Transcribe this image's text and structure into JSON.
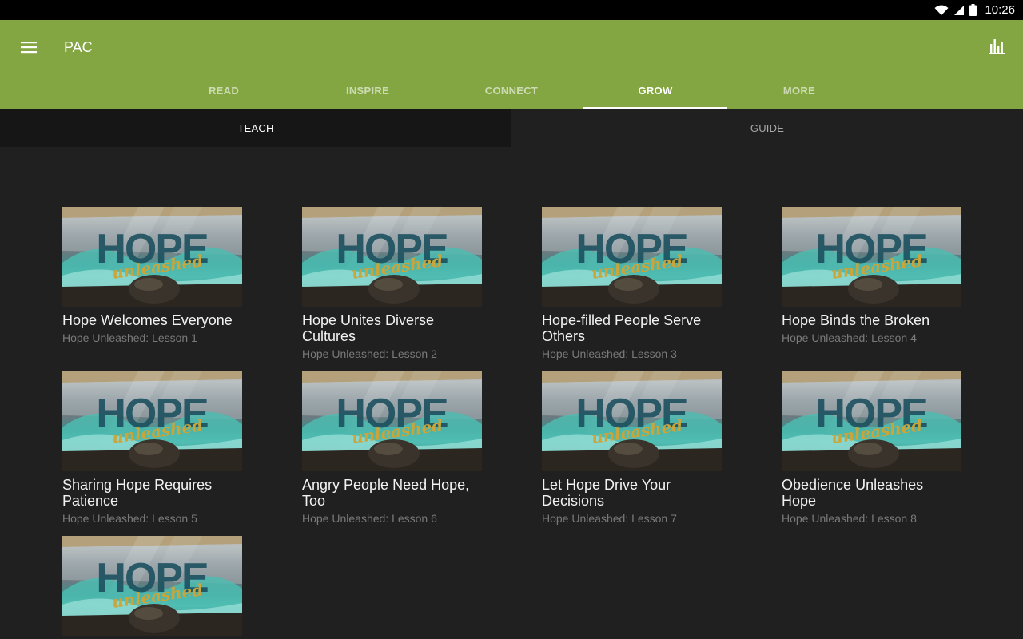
{
  "status_bar": {
    "time": "10:26"
  },
  "app_bar": {
    "title": "PAC"
  },
  "tabs": [
    {
      "label": "READ",
      "active": false
    },
    {
      "label": "INSPIRE",
      "active": false
    },
    {
      "label": "CONNECT",
      "active": false
    },
    {
      "label": "GROW",
      "active": true
    },
    {
      "label": "MORE",
      "active": false
    }
  ],
  "subtabs": [
    {
      "label": "TEACH",
      "active": true
    },
    {
      "label": "GUIDE",
      "active": false
    }
  ],
  "thumbnail": {
    "word": "HOPE",
    "script": "unleashed"
  },
  "lessons": [
    {
      "title": "Hope Welcomes Everyone",
      "subtitle": "Hope Unleashed: Lesson 1"
    },
    {
      "title": "Hope Unites Diverse Cultures",
      "subtitle": "Hope Unleashed: Lesson 2"
    },
    {
      "title": "Hope-filled People Serve Others",
      "subtitle": "Hope Unleashed: Lesson 3"
    },
    {
      "title": "Hope Binds the Broken",
      "subtitle": "Hope Unleashed: Lesson 4"
    },
    {
      "title": "Sharing Hope Requires Patience",
      "subtitle": "Hope Unleashed: Lesson 5"
    },
    {
      "title": "Angry People Need Hope, Too",
      "subtitle": "Hope Unleashed: Lesson 6"
    },
    {
      "title": "Let Hope Drive Your Decisions",
      "subtitle": "Hope Unleashed: Lesson 7"
    },
    {
      "title": "Obedience Unleashes Hope",
      "subtitle": "Hope Unleashed: Lesson 8"
    },
    {
      "title": "",
      "subtitle": ""
    }
  ],
  "colors": {
    "app_bar": "#83a642",
    "background": "#202020",
    "active_subtab": "#161616"
  }
}
